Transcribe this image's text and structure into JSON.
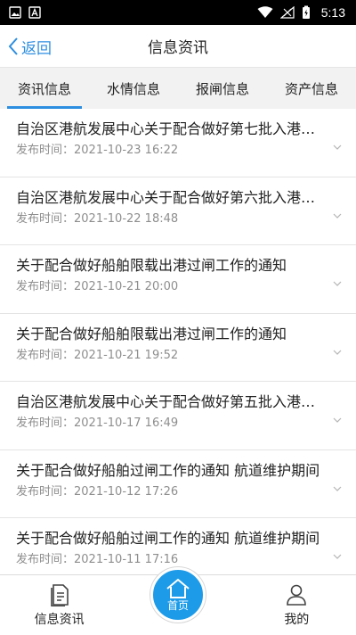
{
  "status_bar": {
    "time": "5:13"
  },
  "nav": {
    "back_label": "返回",
    "title": "信息资讯"
  },
  "tabs": [
    {
      "label": "资讯信息",
      "active": true
    },
    {
      "label": "水情信息",
      "active": false
    },
    {
      "label": "报闸信息",
      "active": false
    },
    {
      "label": "资产信息",
      "active": false
    }
  ],
  "news": [
    {
      "title": "自治区港航发展中心关于配合做好第七批入港船舶检查工作的通知",
      "date": "发布时间：2021-10-23 16:22"
    },
    {
      "title": "自治区港航发展中心关于配合做好第六批入港船舶检查工作的通知",
      "date": "发布时间：2021-10-22 18:48"
    },
    {
      "title": "关于配合做好船舶限载出港过闸工作的通知",
      "date": "发布时间：2021-10-21 20:00"
    },
    {
      "title": "关于配合做好船舶限载出港过闸工作的通知",
      "date": "发布时间：2021-10-21 19:52"
    },
    {
      "title": "自治区港航发展中心关于配合做好第五批入港船舶检查工作的通知",
      "date": "发布时间：2021-10-17 16:49"
    },
    {
      "title": "关于配合做好船舶过闸工作的通知 航道维护期间",
      "date": "发布时间：2021-10-12 17:26"
    },
    {
      "title": "关于配合做好船舶过闸工作的通知 航道维护期间",
      "date": "发布时间：2021-10-11 17:16"
    }
  ],
  "bottom_nav": {
    "info_label": "信息资讯",
    "home_label": "首页",
    "mine_label": "我的"
  },
  "colors": {
    "accent": "#2d8ee0",
    "home_button": "#1e9be8"
  }
}
